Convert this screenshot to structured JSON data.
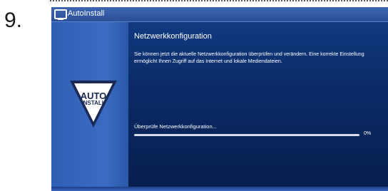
{
  "step_number": "9.",
  "window": {
    "title": "AutoInstall",
    "icon": "tv-icon"
  },
  "logo": {
    "line1": "AUTO",
    "line2": "INSTALL"
  },
  "content": {
    "heading": "Netzwerkkonfiguration",
    "description": "Sie können jetzt die aktuelle Netzwerkkonfiguration überprüfen und verändern. Eine korrekte Einstellung ermöglicht Ihnen Zugriff auf das Internet und lokale Mediendateien.",
    "status": "Überprüfe Netzwerkkonfiguration...",
    "progress_label": "0%",
    "progress_fraction": 0
  },
  "colors": {
    "screen_bg": "#0b1f4d",
    "title_bar": "#2a4f97",
    "sidebar": "#3a6cc2",
    "progress_track": "#d9dde6"
  }
}
